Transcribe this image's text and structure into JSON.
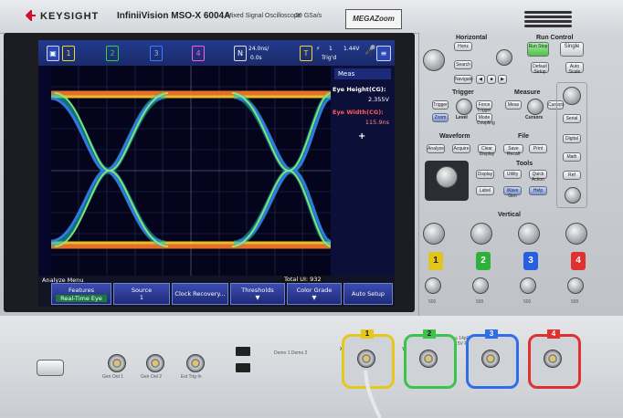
{
  "brand": {
    "name": "KEYSIGHT",
    "model": "InfiniiVision MSO-X 6004A",
    "subtitle": "Mixed Signal Oscilloscope",
    "sample_rate": "20 GSa/s",
    "badge": "MEGAZoom"
  },
  "channel_bar": {
    "channels": [
      "1",
      "2",
      "3",
      "4"
    ],
    "digital_label": "N",
    "timebase": "24.0ns/",
    "delay": "0.0s",
    "trigger_label": "T",
    "trigger_state": "Trig'd",
    "trigger_num": "1",
    "trigger_level": "1.44V"
  },
  "measurements": {
    "header": "Meas",
    "items": [
      {
        "label": "Eye Height(CG):",
        "value": "2.355V",
        "color": "#ffffff"
      },
      {
        "label": "Eye Width(CG):",
        "value": "115.9ns",
        "color": "#ff5a5a"
      }
    ],
    "add": "+"
  },
  "analyze_menu": {
    "title": "Analyze Menu",
    "total_ui": "Total UI: 932",
    "softkeys": [
      {
        "title": "Features",
        "value": "Real-Time Eye"
      },
      {
        "title": "Source",
        "value": "1"
      },
      {
        "title": "Clock Recovery...",
        "value": ""
      },
      {
        "title": "Thresholds",
        "value": "▼"
      },
      {
        "title": "Color Grade",
        "value": "▼"
      },
      {
        "title": "Auto Setup",
        "value": ""
      }
    ]
  },
  "panel": {
    "horizontal": "Horizontal",
    "run_control": "Run Control",
    "trigger": "Trigger",
    "measure": "Measure",
    "waveform": "Waveform",
    "file": "File",
    "tools": "Tools",
    "vertical": "Vertical",
    "buttons": {
      "horiz": "Horiz",
      "search": "Search",
      "navigate": "Navigate",
      "run_stop": "Run Stop",
      "single": "Single",
      "default_setup": "Default Setup",
      "auto_scale": "Auto Scale",
      "trigger": "Trigger",
      "force": "Force Trigger",
      "mode_coupling": "Mode Coupling",
      "meas": "Meas",
      "cursors": "Cursors",
      "zoom": "Zoom",
      "analyze": "Analyze",
      "acquire": "Acquire",
      "clear_display": "Clear Display",
      "save_recall": "Save Recall",
      "print": "Print",
      "utility": "Utility",
      "quick_action": "Quick Action",
      "wavegen": "Wave Gen",
      "display": "Display",
      "label": "Label",
      "help": "Help",
      "serial": "Serial",
      "digital": "Digital",
      "math": "Math",
      "ref": "Ref",
      "level": "Level",
      "cursors_knob": "Cursors"
    },
    "vertical_channels": [
      "1",
      "2",
      "3",
      "4"
    ],
    "vertical_values": [
      "500",
      "500",
      "500",
      "500"
    ]
  },
  "bottom": {
    "gen_out_1": "Gen Out 1",
    "gen_out_2": "Gen Out 2",
    "ext_trig_in": "Ext Trig In",
    "demo": "Demo 1   Demo 2",
    "inputs": [
      "1",
      "2",
      "3",
      "4"
    ],
    "input_spec": "1MΩ ≤ 14pF / 50Ω ≤ 5V RMS",
    "x_label": "X",
    "y_label": "Y"
  },
  "colors": {
    "ch1": "#f1d820",
    "ch2": "#3ccf3c",
    "ch3": "#3b7bff",
    "ch4": "#ff3b3b",
    "accent": "#1b2b7a"
  }
}
